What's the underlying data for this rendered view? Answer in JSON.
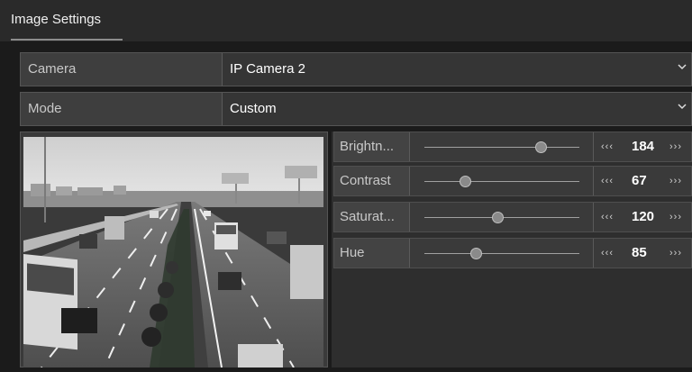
{
  "title": {
    "tab": "Image Settings"
  },
  "camera": {
    "label": "Camera",
    "value": "IP Camera 2"
  },
  "mode": {
    "label": "Mode",
    "value": "Custom"
  },
  "adjust": [
    {
      "name": "Brightn...",
      "value": "184",
      "level": 0.75,
      "dec": "‹‹‹",
      "inc": "›››"
    },
    {
      "name": "Contrast",
      "value": "67",
      "level": 0.26,
      "dec": "‹‹‹",
      "inc": "›››"
    },
    {
      "name": "Saturat...",
      "value": "120",
      "level": 0.47,
      "dec": "‹‹‹",
      "inc": "›››"
    },
    {
      "name": "Hue",
      "value": "85",
      "level": 0.33,
      "dec": "‹‹‹",
      "inc": "›››"
    }
  ],
  "colors": {
    "bg": "#1b1b1b",
    "row_bg": "#353535",
    "label_bg": "#3e3e3e",
    "text": "#ffffff"
  }
}
